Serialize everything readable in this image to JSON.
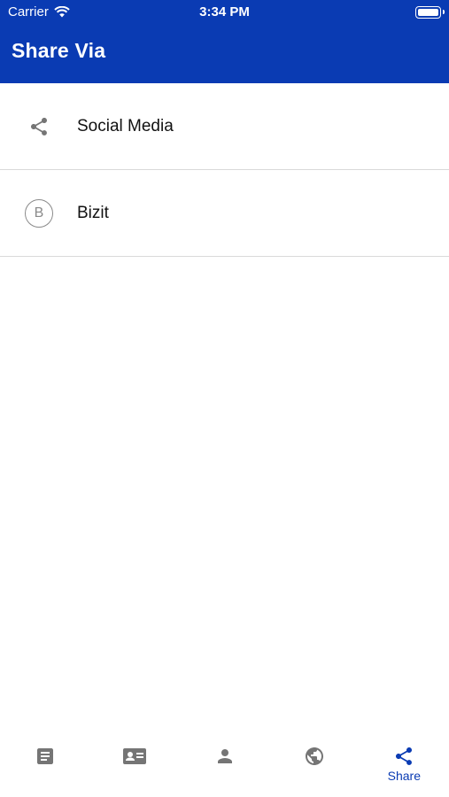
{
  "status_bar": {
    "carrier": "Carrier",
    "time": "3:34 PM"
  },
  "header": {
    "title": "Share Via"
  },
  "share_options": [
    {
      "label": "Social Media",
      "icon": "share-icon"
    },
    {
      "label": "Bizit",
      "icon": "b-circle-icon",
      "icon_letter": "B"
    }
  ],
  "tab_bar": {
    "tabs": [
      {
        "icon": "document-icon",
        "label": ""
      },
      {
        "icon": "contact-card-icon",
        "label": ""
      },
      {
        "icon": "person-icon",
        "label": ""
      },
      {
        "icon": "globe-icon",
        "label": ""
      },
      {
        "icon": "share-icon",
        "label": "Share",
        "active": true
      }
    ]
  },
  "colors": {
    "header_bg": "#0a3bb3",
    "accent": "#0a3bb3",
    "icon_gray": "#757575"
  }
}
